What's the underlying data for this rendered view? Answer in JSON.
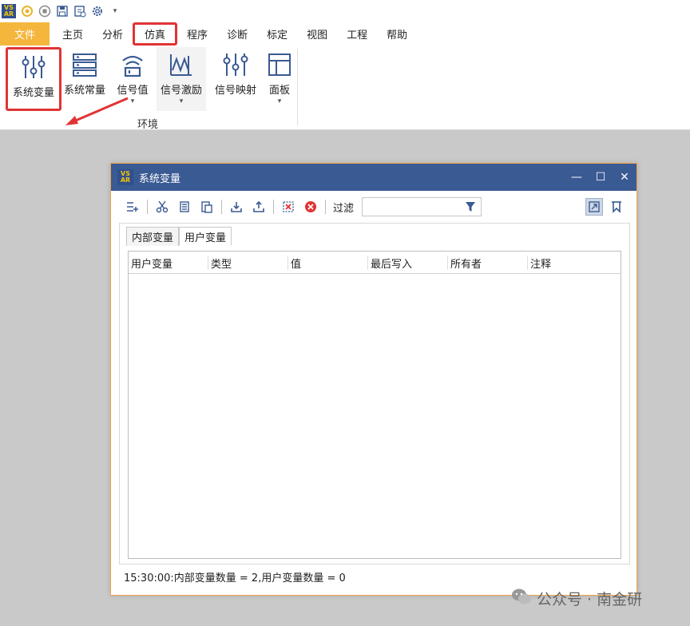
{
  "app": {
    "logo_text": "VSAR",
    "quick_access": [
      "connect-icon",
      "stop-icon",
      "save-icon",
      "save-as-icon",
      "settings-icon",
      "customize-caret-icon"
    ]
  },
  "menu": {
    "file": "文件",
    "items": [
      "主页",
      "分析",
      "仿真",
      "程序",
      "诊断",
      "标定",
      "视图",
      "工程",
      "帮助"
    ],
    "highlighted": "仿真"
  },
  "ribbon": {
    "buttons": [
      {
        "label": "系统变量",
        "icon": "sliders-icon",
        "dropdown": false
      },
      {
        "label": "系统常量",
        "icon": "list-icon",
        "dropdown": false
      },
      {
        "label": "信号值",
        "icon": "signal-icon",
        "dropdown": true
      },
      {
        "label": "信号激励",
        "icon": "waveform-icon",
        "dropdown": true
      },
      {
        "label": "信号映射",
        "icon": "mapping-icon",
        "dropdown": false
      },
      {
        "label": "面板",
        "icon": "panel-icon",
        "dropdown": true
      }
    ],
    "group_label": "环境",
    "highlight_color": "#e03434"
  },
  "dialog": {
    "title": "系统变量",
    "title_bg": "#3a5a93",
    "filter_label": "过滤",
    "filter_value": "",
    "tabs": [
      "内部变量",
      "用户变量"
    ],
    "active_tab": "用户变量",
    "columns": [
      "用户变量",
      "类型",
      "值",
      "最后写入",
      "所有者",
      "注释"
    ],
    "status": "15:30:00:内部变量数量 = 2,用户变量数量 = 0"
  },
  "watermark": {
    "text": "公众号 · 南金研"
  }
}
